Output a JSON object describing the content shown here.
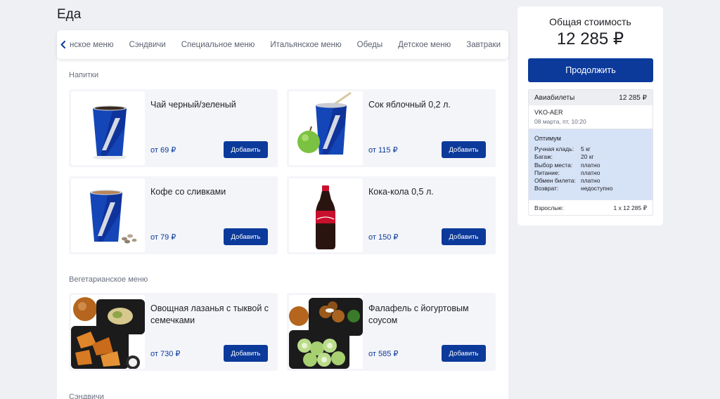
{
  "page": {
    "title": "Еда"
  },
  "tabs": {
    "items": [
      "нское меню",
      "Сэндвичи",
      "Специальное меню",
      "Итальянское меню",
      "Обеды",
      "Детское меню",
      "Завтраки"
    ]
  },
  "sections": {
    "drinks": "Напитки",
    "vegetarian": "Вегетарианское меню",
    "sandwiches": "Сэндвичи"
  },
  "products": {
    "tea": {
      "name": "Чай черный/зеленый",
      "price": "от 69 ₽",
      "add": "Добавить"
    },
    "juice": {
      "name": "Сок яблочный 0,2 л.",
      "price": "от 115 ₽",
      "add": "Добавить"
    },
    "coffee": {
      "name": "Кофе со сливками",
      "price": "от 79 ₽",
      "add": "Добавить"
    },
    "cola": {
      "name": "Кока-кола 0,5 л.",
      "price": "от 150 ₽",
      "add": "Добавить"
    },
    "lasagna": {
      "name": "Овощная лазанья с тыквой с семечками",
      "price": "от 730 ₽",
      "add": "Добавить"
    },
    "falafel": {
      "name": "Фалафель с йогуртовым соусом",
      "price": "от 585 ₽",
      "add": "Добавить"
    }
  },
  "summary": {
    "title": "Общая стоимость",
    "amount": "12 285 ₽",
    "continue": "Продолжить",
    "tickets_label": "Авиабилеты",
    "tickets_amount": "12 285 ₽",
    "route": "VKO-AER",
    "date": "08 марта, пт, 10:20",
    "tariff": "Оптимум",
    "rows": [
      {
        "k": "Ручная кладь:",
        "v": "5 кг"
      },
      {
        "k": "Багаж:",
        "v": "20 кг"
      },
      {
        "k": "Выбор места:",
        "v": "платно"
      },
      {
        "k": "Питание:",
        "v": "платно"
      },
      {
        "k": "Обмен билета:",
        "v": "платно"
      },
      {
        "k": "Возврат:",
        "v": "недоступно"
      }
    ],
    "passengers_label": "Взрослые:",
    "passengers_value": "1 x 12 285 ₽"
  },
  "colors": {
    "accent": "#0b3a9b",
    "background": "#eef0f4",
    "tariff_bg": "#d6e2f6"
  }
}
